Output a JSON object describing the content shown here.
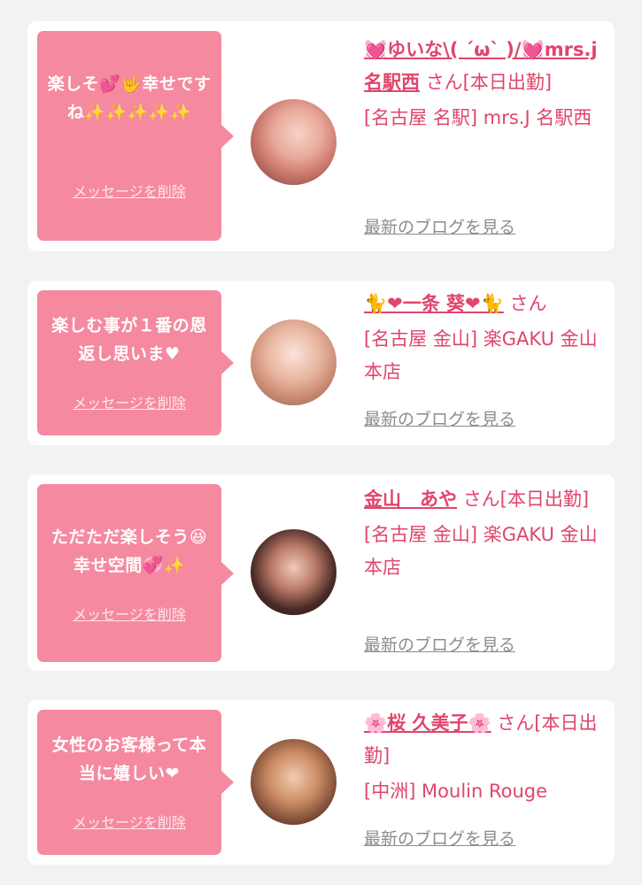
{
  "cards": [
    {
      "message": "楽しそ💕🤟幸せですね✨✨✨✨✨",
      "delete_label": "メッセージを削除",
      "name": "💓ゆいな\\( ´ω` )/💓mrs.j名駅西",
      "name_suffix": "さん[本日出勤]",
      "shop": "[名古屋 名駅] mrs.J 名駅西",
      "blog_link": "最新のブログを見る"
    },
    {
      "message": "楽しむ事が１番の恩返し思いま♥",
      "delete_label": "メッセージを削除",
      "name": "🐈❤一条 葵❤🐈",
      "name_suffix": "さん",
      "shop": "[名古屋 金山] 楽GAKU 金山本店",
      "blog_link": "最新のブログを見る"
    },
    {
      "message": "ただただ楽しそう😆幸せ空間💞✨",
      "delete_label": "メッセージを削除",
      "name": "金山　あや",
      "name_suffix": "さん[本日出勤]",
      "shop": "[名古屋 金山] 楽GAKU 金山本店",
      "blog_link": "最新のブログを見る"
    },
    {
      "message": "女性のお客様って本当に嬉しい❤",
      "delete_label": "メッセージを削除",
      "name": "🌸桜 久美子🌸",
      "name_suffix": "さん[本日出勤]",
      "shop": "[中洲] Moulin Rouge",
      "blog_link": "最新のブログを見る"
    }
  ],
  "colors": {
    "accent": "#e0456b",
    "bubble": "#f5899f",
    "background": "#f4f1f2",
    "link_gray": "#8c8c8c"
  }
}
